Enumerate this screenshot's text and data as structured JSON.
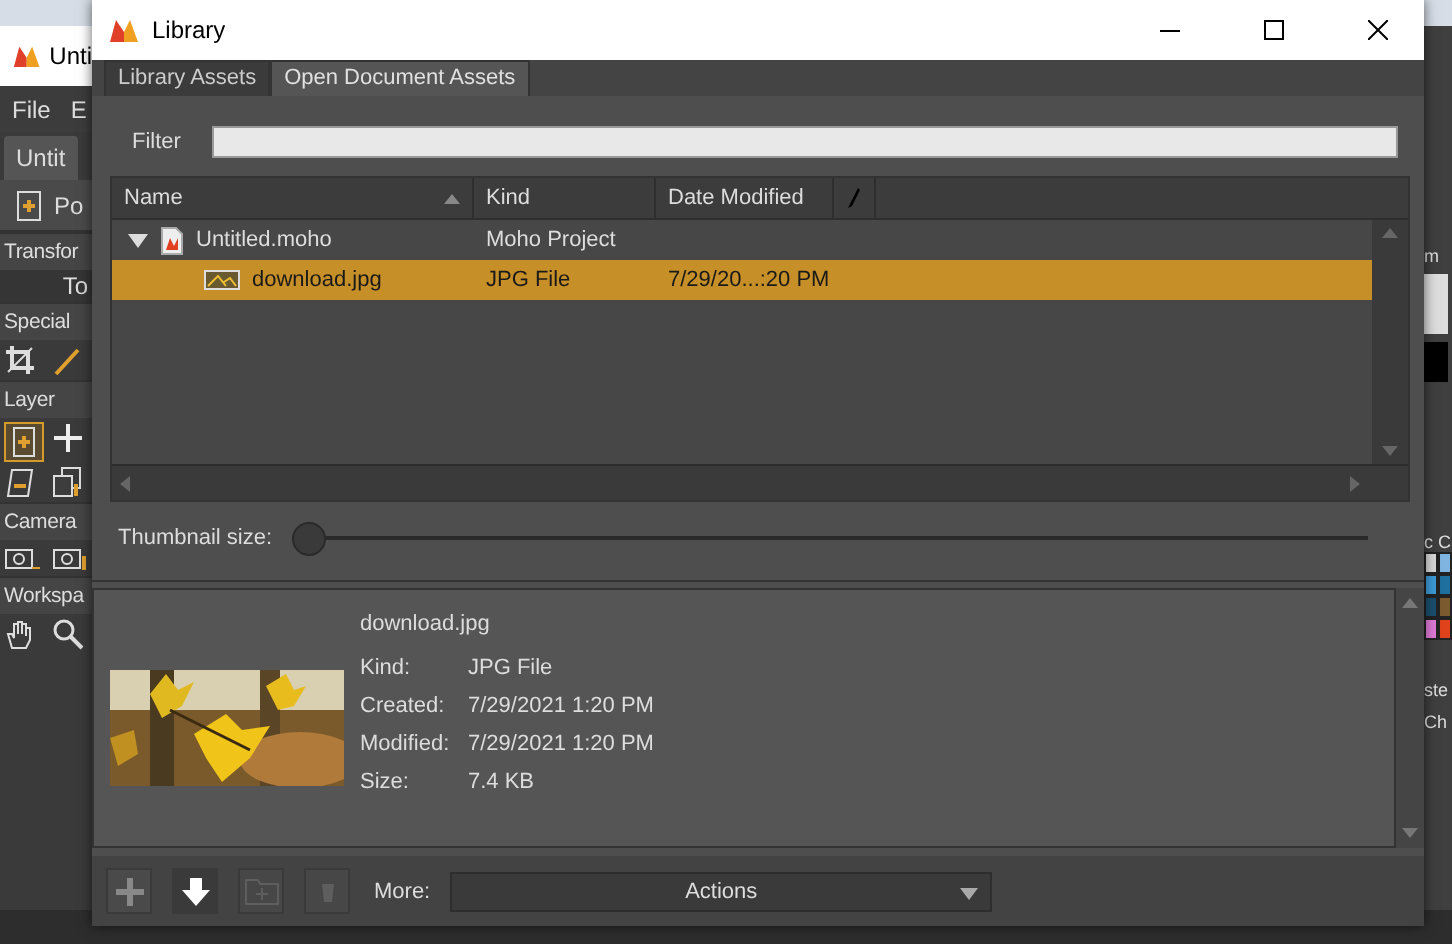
{
  "background_app": {
    "title": "Unti",
    "menu": [
      "File",
      "E"
    ],
    "document_tab": "Untit",
    "tool_label": "Po",
    "sections": [
      {
        "title": "Transfor",
        "button": "To"
      },
      {
        "title": "Special"
      },
      {
        "title": "Layer"
      },
      {
        "title": "Camera"
      },
      {
        "title": "Workspa"
      }
    ],
    "right_labels": [
      "m",
      "c C",
      "ste",
      "Ch"
    ],
    "swatches": [
      {
        "color": "#d8d8d8"
      },
      {
        "color": "#7fb3e0"
      },
      {
        "color": "#3d9ad6"
      },
      {
        "color": "#1f6f9e"
      },
      {
        "color": "#1b4f6e"
      },
      {
        "color": "#7a5a2e"
      },
      {
        "color": "#e07ad8"
      },
      {
        "color": "#e0421c"
      }
    ]
  },
  "window": {
    "title": "Library"
  },
  "tabs": [
    {
      "label": "Library Assets",
      "selected": false
    },
    {
      "label": "Open Document Assets",
      "selected": true
    }
  ],
  "filter": {
    "label": "Filter"
  },
  "table": {
    "columns": [
      "Name",
      "Kind",
      "Date Modified"
    ],
    "rows": [
      {
        "name": "Untitled.moho",
        "kind": "Moho Project",
        "expanded": true,
        "selected": false,
        "children": [
          {
            "name": "download.jpg",
            "kind": "JPG File",
            "date": "7/29/20...:20 PM",
            "selected": true
          }
        ]
      }
    ]
  },
  "thumbnail_size": {
    "label": "Thumbnail size:",
    "level": 0
  },
  "preview": {
    "filename": "download.jpg",
    "fields": [
      {
        "label": "Kind:",
        "value": "JPG File"
      },
      {
        "label": "Created:",
        "value": "7/29/2021 1:20 PM"
      },
      {
        "label": "Modified:",
        "value": "7/29/2021 1:20 PM"
      },
      {
        "label": "Size:",
        "value": "7.4 KB"
      }
    ]
  },
  "toolbar": {
    "buttons": [
      {
        "kind": "add",
        "disabled": false
      },
      {
        "kind": "import",
        "disabled": false
      },
      {
        "kind": "new-folder",
        "disabled": true
      },
      {
        "kind": "delete",
        "disabled": true
      }
    ],
    "more_label": "More:",
    "actions": "Actions"
  }
}
